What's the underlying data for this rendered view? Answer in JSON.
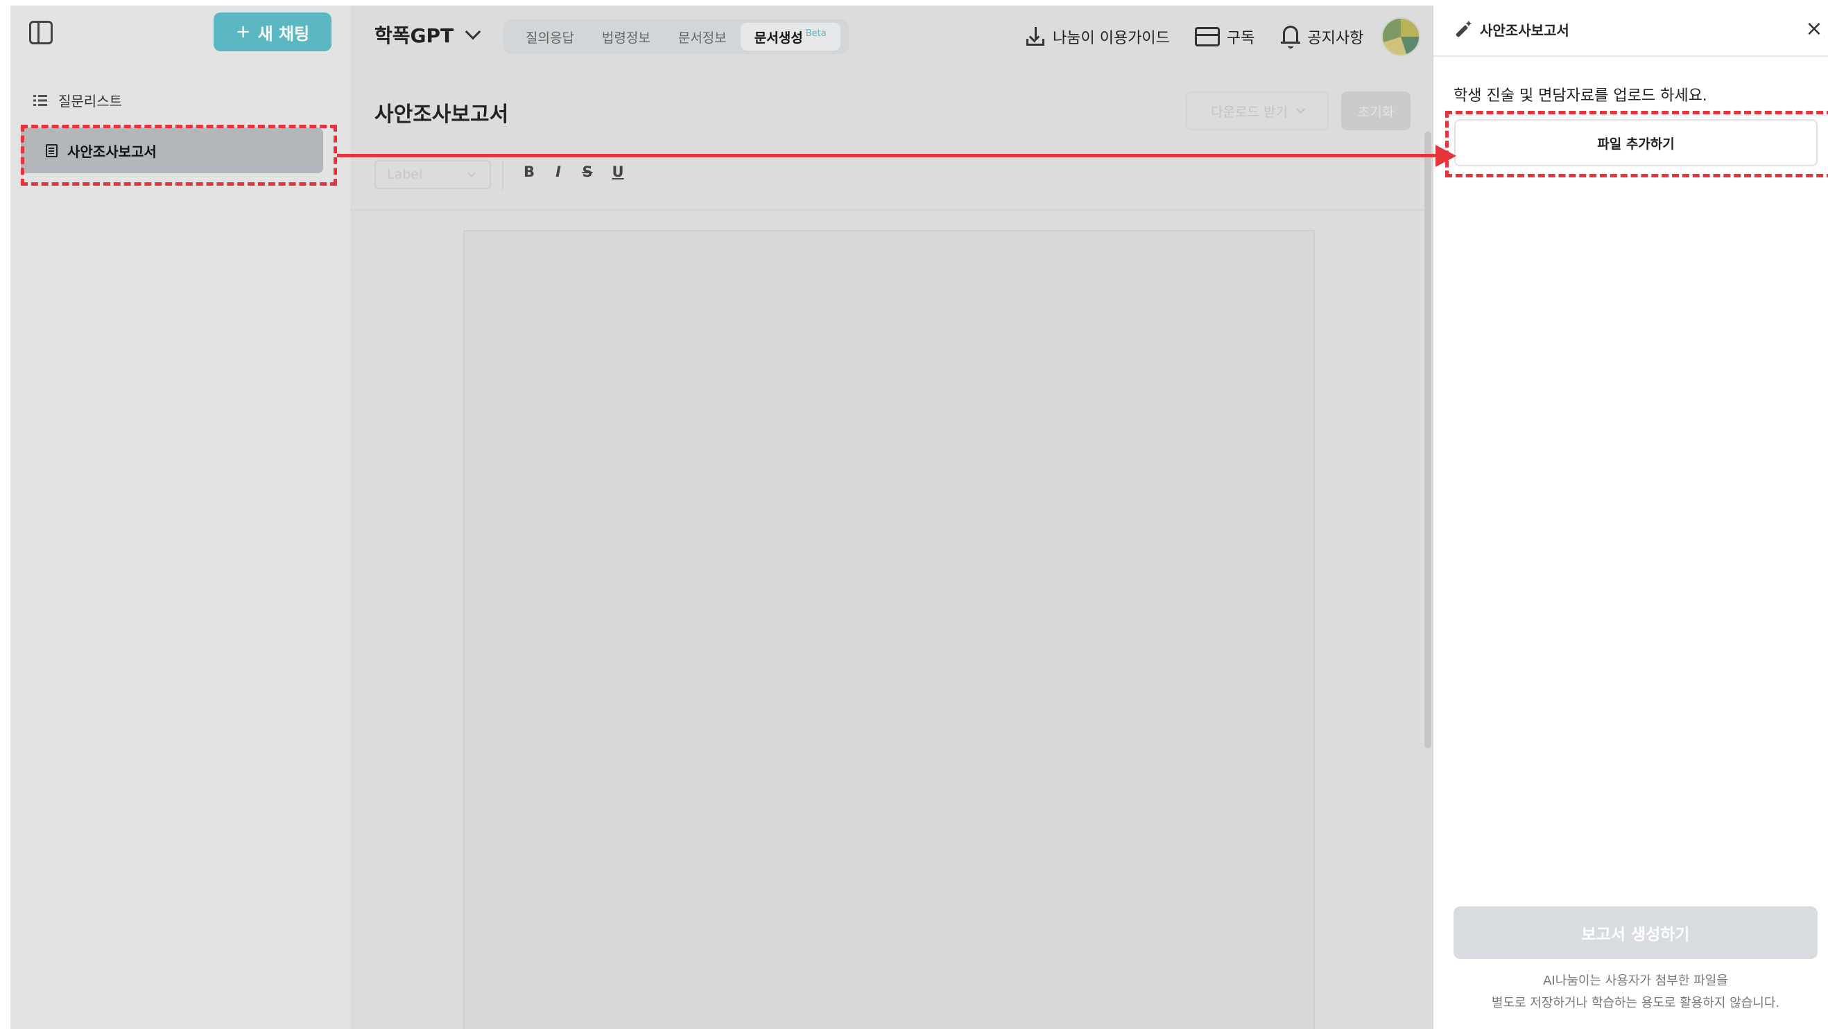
{
  "sidebar": {
    "new_chat_label": "새 채팅",
    "new_chat_prefix": "+",
    "question_list_label": "질문리스트",
    "items": [
      {
        "label": "사안조사보고서",
        "selected": true
      }
    ]
  },
  "header": {
    "app_title": "학폭GPT",
    "tabs": [
      {
        "label": "질의응답",
        "active": false
      },
      {
        "label": "법령정보",
        "active": false
      },
      {
        "label": "문서정보",
        "active": false
      },
      {
        "label": "문서생성",
        "active": true,
        "badge": "Beta"
      }
    ],
    "guide_label": "나눔이 이용가이드",
    "subscribe_label": "구독",
    "notice_label": "공지사항"
  },
  "document": {
    "title": "사안조사보고서",
    "download_label": "다운로드 받기",
    "reset_label": "초기화",
    "style_select_value": "Label",
    "format_buttons": [
      "B",
      "I",
      "S",
      "U"
    ]
  },
  "right_panel": {
    "title": "사안조사보고서",
    "close_glyph": "×",
    "instruction": "학생 진술 및 면담자료를 업로드 하세요.",
    "add_file_label": "파일 추가하기",
    "generate_label": "보고서 생성하기",
    "privacy_notice_line1": "AI나눔이는 사용자가 첨부한 파일을",
    "privacy_notice_line2": "별도로 저장하거나 학습하는 용도로 활용하지 않습니다."
  },
  "colors": {
    "accent": "#5bb8c3",
    "annotation": "#e5343a",
    "selected_item": "#b3b6ba"
  }
}
